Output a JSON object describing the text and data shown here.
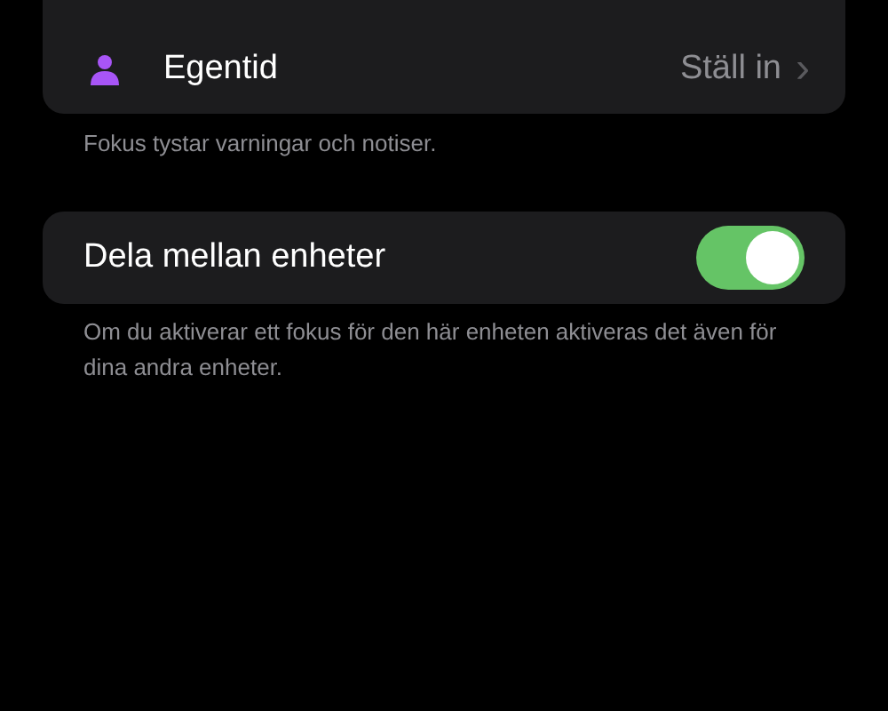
{
  "focus_list": {
    "items": [
      {
        "label": "Egentid",
        "value": "Ställ in",
        "chevron": "›"
      }
    ],
    "footer": "Fokus tystar varningar och notiser."
  },
  "share": {
    "label": "Dela mellan enheter",
    "on": true,
    "footer": "Om du aktiverar ett fokus för den här enheten aktiveras det även för dina andra enheter."
  }
}
